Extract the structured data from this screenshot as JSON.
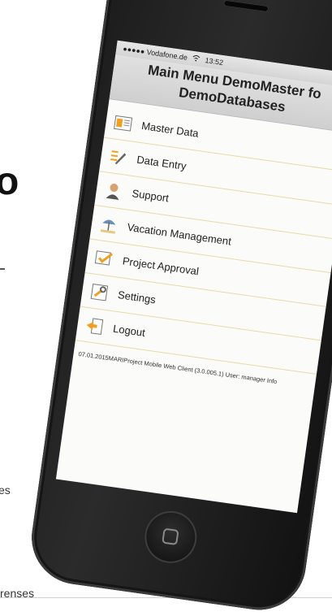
{
  "background": {
    "heading_fragment": "o",
    "text_fragment_1": "es",
    "text_fragment_2": "renses"
  },
  "status_bar": {
    "carrier": "●●●●● Vodafone.de",
    "time": "13:52",
    "bluetooth": "✱"
  },
  "header": {
    "title_line1": "Main Menu DemoMaster fo",
    "title_line2": "DemoDatabases"
  },
  "menu": {
    "items": [
      {
        "label": "Master Data",
        "icon": "master-data-icon"
      },
      {
        "label": "Data Entry",
        "icon": "data-entry-icon"
      },
      {
        "label": "Support",
        "icon": "support-icon"
      },
      {
        "label": "Vacation Management",
        "icon": "vacation-icon"
      },
      {
        "label": "Project Approval",
        "icon": "project-approval-icon"
      },
      {
        "label": "Settings",
        "icon": "settings-icon"
      },
      {
        "label": "Logout",
        "icon": "logout-icon"
      }
    ]
  },
  "footer": {
    "text": "07.01.2015MARIProject Mobile Web Client (3.0.005.1) User: manager Info"
  },
  "colors": {
    "accent_line": "#e9d9a8",
    "icon_orange": "#f0a020",
    "title_bg": "#d6d6d6"
  }
}
